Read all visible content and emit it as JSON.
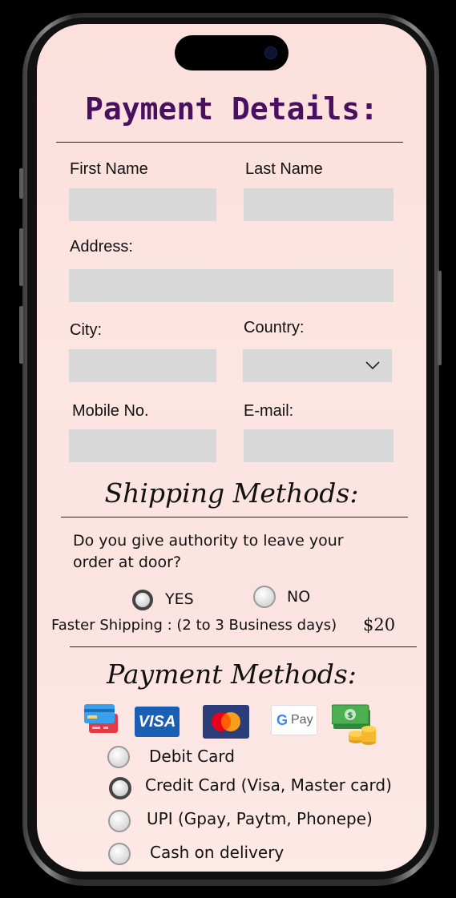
{
  "form": {
    "title": "Payment Details:",
    "fields": {
      "first_name": {
        "label": "First Name",
        "value": ""
      },
      "last_name": {
        "label": "Last Name",
        "value": ""
      },
      "address": {
        "label": "Address:",
        "value": ""
      },
      "city": {
        "label": "City:",
        "value": ""
      },
      "country": {
        "label": "Country:",
        "value": ""
      },
      "mobile": {
        "label": "Mobile No.",
        "value": ""
      },
      "email": {
        "label": "E-mail:",
        "value": ""
      }
    }
  },
  "shipping": {
    "title": "Shipping Methods:",
    "question_line1": "Do you give authority to leave your",
    "question_line2": "order at door?",
    "yes_label": "YES",
    "no_label": "NO",
    "selected": "YES",
    "faster_label": "Faster Shipping :  (2 to 3 Business days)",
    "faster_price": "$20"
  },
  "payment": {
    "title": "Payment Methods:",
    "icons": [
      "card-icon",
      "visa-icon",
      "mastercard-icon",
      "gpay-icon",
      "cash-icon"
    ],
    "visa_text": "VISA",
    "gpay_text": "Pay",
    "gpay_g": "G",
    "options": [
      {
        "label": "Debit Card",
        "selected": false
      },
      {
        "label": "Credit Card (Visa, Master card)",
        "selected": true
      },
      {
        "label": "UPI (Gpay, Paytm, Phonepe)",
        "selected": false
      },
      {
        "label": "Cash on delivery",
        "selected": false
      }
    ]
  },
  "colors": {
    "title": "#4a1060",
    "screen_bg": "#fde5e2",
    "field_bg": "#d8d8d8",
    "visa_blue": "#1a5fb4",
    "mastercard_red": "#eb001b",
    "mastercard_orange": "#f79e1b"
  }
}
